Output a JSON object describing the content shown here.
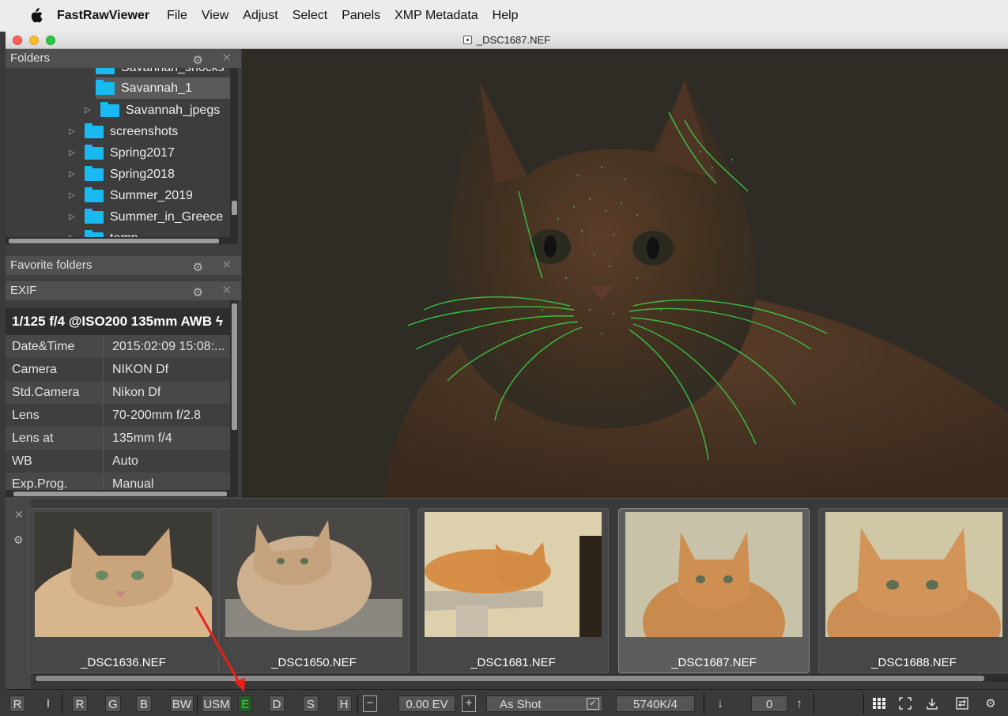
{
  "menubar": {
    "app_name": "FastRawViewer",
    "items": [
      "File",
      "View",
      "Adjust",
      "Select",
      "Panels",
      "XMP Metadata",
      "Help"
    ]
  },
  "window": {
    "title": "_DSC1687.NEF"
  },
  "panels": {
    "folders": {
      "title": "Folders",
      "items": [
        {
          "label": "Savannah_shocks",
          "partial": true
        },
        {
          "label": "Savannah_1",
          "selected": true
        },
        {
          "label": "Savannah_jpegs"
        },
        {
          "label": "screenshots"
        },
        {
          "label": "Spring2017"
        },
        {
          "label": "Spring2018"
        },
        {
          "label": "Summer_2019"
        },
        {
          "label": "Summer_in_Greece"
        },
        {
          "label": "temp",
          "partial": true
        }
      ]
    },
    "favorites": {
      "title": "Favorite folders"
    },
    "exif": {
      "title": "EXIF",
      "summary": "1/125 f/4 @ISO200 135mm AWB",
      "rows": [
        {
          "key": "Date&Time",
          "value": "2015:02:09 15:08:..."
        },
        {
          "key": "Camera",
          "value": "NIKON Df"
        },
        {
          "key": "Std.Camera",
          "value": "Nikon Df"
        },
        {
          "key": "Lens",
          "value": "70-200mm f/2.8"
        },
        {
          "key": "Lens at",
          "value": "135mm f/4"
        },
        {
          "key": "WB",
          "value": "Auto"
        },
        {
          "key": "Exp.Prog.",
          "value": "Manual"
        }
      ]
    }
  },
  "filmstrip": {
    "thumbnails": [
      {
        "name": "_DSC1636.NEF"
      },
      {
        "name": "_DSC1650.NEF"
      },
      {
        "name": "_DSC1681.NEF"
      },
      {
        "name": "_DSC1687.NEF",
        "selected": true
      },
      {
        "name": "_DSC1688.NEF"
      }
    ]
  },
  "toolbar": {
    "r1": "R",
    "i": "I",
    "r": "R",
    "g": "G",
    "b": "B",
    "bw": "BW",
    "usm": "USM",
    "e": "E",
    "d": "D",
    "s": "S",
    "h": "H",
    "minus": "−",
    "ev": "0.00 EV",
    "plus": "+",
    "wb": "As Shot",
    "temp": "5740K/4",
    "down": "↓",
    "value": "0",
    "up": "↑"
  },
  "colors": {
    "folder": "#19b9f2",
    "focus_peaking": "#39d84a",
    "accent_arrow": "#e8201a"
  }
}
